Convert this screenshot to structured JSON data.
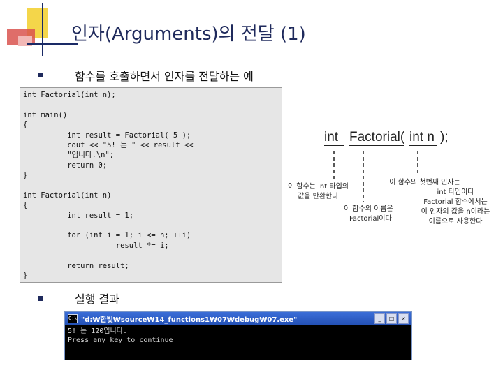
{
  "slide": {
    "title": "인자(Arguments)의 전달 (1)",
    "bullet1": "함수를 호출하면서 인자를 전달하는 예",
    "bullet2": "실행 결과"
  },
  "code": [
    "int Factorial(int n);",
    "",
    "int main()",
    "{",
    "          int result = Factorial( 5 );",
    "          cout << \"5! 는 \" << result <<",
    "          \"입니다.\\n\";",
    "          return 0;",
    "}",
    "",
    "int Factorial(int n)",
    "{",
    "          int result = 1;",
    "",
    "          for (int i = 1; i <= n; ++i)",
    "                     result *= i;",
    "",
    "          return result;",
    "}"
  ],
  "diagram": {
    "sig_int": "int",
    "sig_factorial": "Factorial(",
    "sig_param": "int n",
    "sig_close": ");",
    "note1": [
      "이 함수는 int 타입의",
      "값을 반환한다"
    ],
    "note2": [
      "이 함수의 이름은",
      "Factorial이다"
    ],
    "note3": [
      "이 함수의 첫번째 인자는",
      "int 타입이다",
      "Factorial 함수에서는",
      "이 인자의 값을 n이라는",
      "이름으로 사용한다"
    ]
  },
  "console": {
    "title": "\"d:₩한빛₩source₩14_functions1₩07₩debug₩07.exe\"",
    "icon": "C:\\",
    "lines": [
      "5! 는 120입니다.",
      "Press any key to continue"
    ],
    "buttons": {
      "minimize": "_",
      "maximize": "□",
      "close": "×"
    }
  },
  "colors": {
    "title": "#1f2a5c",
    "accent_yellow": "#f4d64a",
    "accent_red": "#d9534f",
    "code_bg": "#e6e6e6",
    "console_bar": "#2451b6"
  }
}
